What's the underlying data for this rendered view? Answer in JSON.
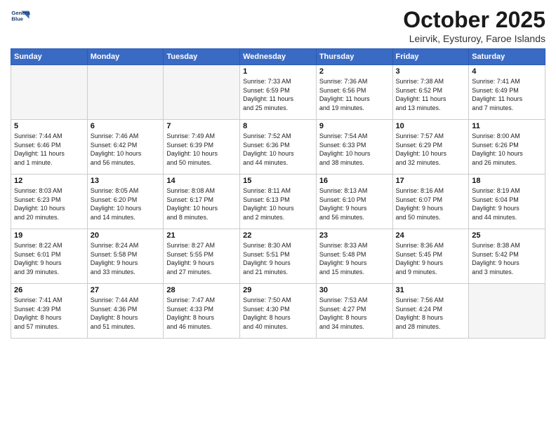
{
  "header": {
    "logo_line1": "General",
    "logo_line2": "Blue",
    "month": "October 2025",
    "location": "Leirvik, Eysturoy, Faroe Islands"
  },
  "weekdays": [
    "Sunday",
    "Monday",
    "Tuesday",
    "Wednesday",
    "Thursday",
    "Friday",
    "Saturday"
  ],
  "weeks": [
    [
      {
        "day": "",
        "info": ""
      },
      {
        "day": "",
        "info": ""
      },
      {
        "day": "",
        "info": ""
      },
      {
        "day": "1",
        "info": "Sunrise: 7:33 AM\nSunset: 6:59 PM\nDaylight: 11 hours\nand 25 minutes."
      },
      {
        "day": "2",
        "info": "Sunrise: 7:36 AM\nSunset: 6:56 PM\nDaylight: 11 hours\nand 19 minutes."
      },
      {
        "day": "3",
        "info": "Sunrise: 7:38 AM\nSunset: 6:52 PM\nDaylight: 11 hours\nand 13 minutes."
      },
      {
        "day": "4",
        "info": "Sunrise: 7:41 AM\nSunset: 6:49 PM\nDaylight: 11 hours\nand 7 minutes."
      }
    ],
    [
      {
        "day": "5",
        "info": "Sunrise: 7:44 AM\nSunset: 6:46 PM\nDaylight: 11 hours\nand 1 minute."
      },
      {
        "day": "6",
        "info": "Sunrise: 7:46 AM\nSunset: 6:42 PM\nDaylight: 10 hours\nand 56 minutes."
      },
      {
        "day": "7",
        "info": "Sunrise: 7:49 AM\nSunset: 6:39 PM\nDaylight: 10 hours\nand 50 minutes."
      },
      {
        "day": "8",
        "info": "Sunrise: 7:52 AM\nSunset: 6:36 PM\nDaylight: 10 hours\nand 44 minutes."
      },
      {
        "day": "9",
        "info": "Sunrise: 7:54 AM\nSunset: 6:33 PM\nDaylight: 10 hours\nand 38 minutes."
      },
      {
        "day": "10",
        "info": "Sunrise: 7:57 AM\nSunset: 6:29 PM\nDaylight: 10 hours\nand 32 minutes."
      },
      {
        "day": "11",
        "info": "Sunrise: 8:00 AM\nSunset: 6:26 PM\nDaylight: 10 hours\nand 26 minutes."
      }
    ],
    [
      {
        "day": "12",
        "info": "Sunrise: 8:03 AM\nSunset: 6:23 PM\nDaylight: 10 hours\nand 20 minutes."
      },
      {
        "day": "13",
        "info": "Sunrise: 8:05 AM\nSunset: 6:20 PM\nDaylight: 10 hours\nand 14 minutes."
      },
      {
        "day": "14",
        "info": "Sunrise: 8:08 AM\nSunset: 6:17 PM\nDaylight: 10 hours\nand 8 minutes."
      },
      {
        "day": "15",
        "info": "Sunrise: 8:11 AM\nSunset: 6:13 PM\nDaylight: 10 hours\nand 2 minutes."
      },
      {
        "day": "16",
        "info": "Sunrise: 8:13 AM\nSunset: 6:10 PM\nDaylight: 9 hours\nand 56 minutes."
      },
      {
        "day": "17",
        "info": "Sunrise: 8:16 AM\nSunset: 6:07 PM\nDaylight: 9 hours\nand 50 minutes."
      },
      {
        "day": "18",
        "info": "Sunrise: 8:19 AM\nSunset: 6:04 PM\nDaylight: 9 hours\nand 44 minutes."
      }
    ],
    [
      {
        "day": "19",
        "info": "Sunrise: 8:22 AM\nSunset: 6:01 PM\nDaylight: 9 hours\nand 39 minutes."
      },
      {
        "day": "20",
        "info": "Sunrise: 8:24 AM\nSunset: 5:58 PM\nDaylight: 9 hours\nand 33 minutes."
      },
      {
        "day": "21",
        "info": "Sunrise: 8:27 AM\nSunset: 5:55 PM\nDaylight: 9 hours\nand 27 minutes."
      },
      {
        "day": "22",
        "info": "Sunrise: 8:30 AM\nSunset: 5:51 PM\nDaylight: 9 hours\nand 21 minutes."
      },
      {
        "day": "23",
        "info": "Sunrise: 8:33 AM\nSunset: 5:48 PM\nDaylight: 9 hours\nand 15 minutes."
      },
      {
        "day": "24",
        "info": "Sunrise: 8:36 AM\nSunset: 5:45 PM\nDaylight: 9 hours\nand 9 minutes."
      },
      {
        "day": "25",
        "info": "Sunrise: 8:38 AM\nSunset: 5:42 PM\nDaylight: 9 hours\nand 3 minutes."
      }
    ],
    [
      {
        "day": "26",
        "info": "Sunrise: 7:41 AM\nSunset: 4:39 PM\nDaylight: 8 hours\nand 57 minutes."
      },
      {
        "day": "27",
        "info": "Sunrise: 7:44 AM\nSunset: 4:36 PM\nDaylight: 8 hours\nand 51 minutes."
      },
      {
        "day": "28",
        "info": "Sunrise: 7:47 AM\nSunset: 4:33 PM\nDaylight: 8 hours\nand 46 minutes."
      },
      {
        "day": "29",
        "info": "Sunrise: 7:50 AM\nSunset: 4:30 PM\nDaylight: 8 hours\nand 40 minutes."
      },
      {
        "day": "30",
        "info": "Sunrise: 7:53 AM\nSunset: 4:27 PM\nDaylight: 8 hours\nand 34 minutes."
      },
      {
        "day": "31",
        "info": "Sunrise: 7:56 AM\nSunset: 4:24 PM\nDaylight: 8 hours\nand 28 minutes."
      },
      {
        "day": "",
        "info": ""
      }
    ]
  ]
}
